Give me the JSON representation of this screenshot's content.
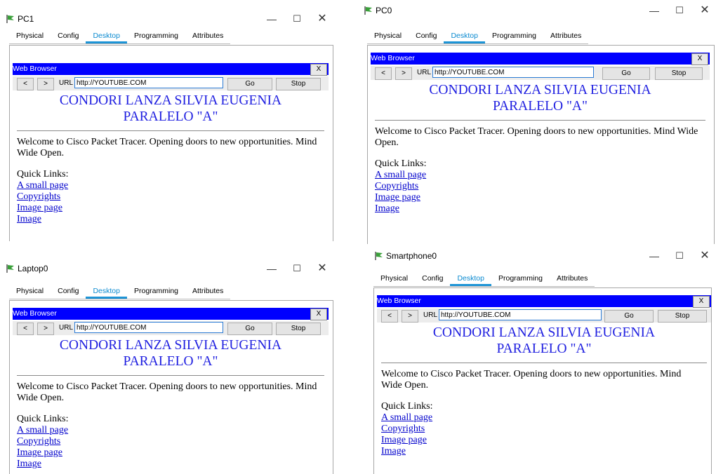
{
  "tabs": [
    "Physical",
    "Config",
    "Desktop",
    "Programming",
    "Attributes"
  ],
  "active_tab": "Desktop",
  "browser": {
    "title": "Web Browser",
    "close_label": "X",
    "back_label": "<",
    "forward_label": ">",
    "url_label": "URL",
    "url_value": "http://YOUTUBE.COM",
    "go_label": "Go",
    "stop_label": "Stop"
  },
  "page": {
    "heading_line1": "CONDORI LANZA SILVIA EUGENIA",
    "heading_line2": "PARALELO \"A\"",
    "welcome": "Welcome to Cisco Packet Tracer. Opening doors to new opportunities. Mind Wide Open.",
    "quick_links_label": "Quick Links:",
    "links": [
      "A small page",
      "Copyrights",
      "Image page",
      "Image"
    ]
  },
  "window_controls": {
    "minimize": "—",
    "maximize": "☐",
    "close": "✕"
  },
  "windows": [
    {
      "title": "PC1"
    },
    {
      "title": "PC0"
    },
    {
      "title": "Laptop0"
    },
    {
      "title": "Smartphone0"
    }
  ]
}
